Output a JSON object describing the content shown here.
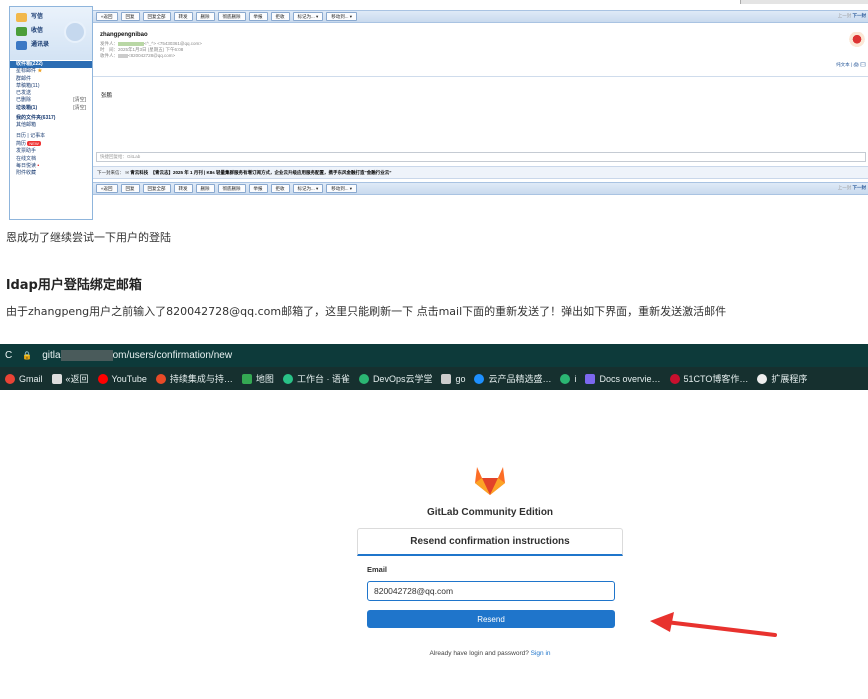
{
  "mail": {
    "nav_top": [
      "写信",
      "收信",
      "通讯录"
    ],
    "folders": [
      {
        "label": "收件箱(222)",
        "note": "",
        "selected": true
      },
      {
        "label": "星标邮件",
        "note": "★"
      },
      {
        "label": "群邮件",
        "note": ""
      },
      {
        "label": "草稿箱(11)",
        "note": ""
      },
      {
        "label": "已发送",
        "note": ""
      },
      {
        "label": "已删除",
        "note": "[清空]"
      },
      {
        "label": "垃圾箱(1)",
        "note": "[清空]"
      }
    ],
    "folders2": [
      {
        "label": "我的文件夹(6317)"
      },
      {
        "label": "其他邮箱"
      }
    ],
    "folders3": [
      {
        "label": "日历 | 记事本"
      },
      {
        "label": "简历",
        "note": "NEW"
      },
      {
        "label": "发票助手"
      },
      {
        "label": "在线文档"
      },
      {
        "label": "每日悦读",
        "note": "•"
      },
      {
        "label": "附件收藏"
      }
    ],
    "toolbar": [
      "«返回",
      "回复",
      "回复全部",
      "转发",
      "删除",
      "彻底删除",
      "举报",
      "拒收",
      "标记为... ▾",
      "移动到... ▾"
    ],
    "nav_right": {
      "prev": "上一封",
      "next": "下一封"
    },
    "subject": "zhangpengnibao",
    "sender_label": "发件人：",
    "sender_value": "<^_^> <75430361@qq.com>",
    "time_label": "时　间：",
    "time_value": "2025年1月3日 (星期五) 下午6:08",
    "to_label": "收件人：",
    "to_value": "<820042728@qq.com>",
    "plain_link": "纯文本 | 🖨 ✉",
    "body": "张鹏",
    "reply_placeholder": "快捷回复给：GitLab",
    "next_label": "下一封来信：",
    "next_sender": "青云科技",
    "next_subject": "【青云志】2025 年 1 月刊 | K8s 轻量集群服务有增订阅方式，企业云升级应用服务配置，携手东风金融打造“金融行业云”"
  },
  "article": {
    "line1": "恩成功了继续尝试一下用户的登陆",
    "heading": "ldap用户登陆绑定邮箱",
    "para": "由于zhangpeng用户之前输入了820042728@qq.com邮箱了，这里只能刷新一下 点击mail下面的重新发送了！弹出如下界面，重新发送激活邮件"
  },
  "browser": {
    "url_prefix": "gitla",
    "url_suffix": "om/users/confirmation/new",
    "bookmarks": [
      {
        "label": "Gmail",
        "color": "#ea4335"
      },
      {
        "label": "«返回",
        "color": "#dddddd"
      },
      {
        "label": "YouTube",
        "color": "#ff0000"
      },
      {
        "label": "持续集成与持…",
        "color": "#e84a27"
      },
      {
        "label": "地图",
        "color": "#34a853"
      },
      {
        "label": "工作台 · 语雀",
        "color": "#29c287"
      },
      {
        "label": "DevOps云学堂",
        "color": "#2bb673"
      },
      {
        "label": "go",
        "color": "#cccccc"
      },
      {
        "label": "云产品精选盛…",
        "color": "#1e90ff"
      },
      {
        "label": "i",
        "color": "#2bb673"
      },
      {
        "label": "Docs overvie…",
        "color": "#7b68ee"
      },
      {
        "label": "51CTO博客作…",
        "color": "#c8102e"
      },
      {
        "label": "扩展程序",
        "color": "#eeeeee"
      }
    ]
  },
  "gitlab": {
    "product": "GitLab Community Edition",
    "card_title": "Resend confirmation instructions",
    "email_label": "Email",
    "email_value": "820042728@qq.com",
    "resend_label": "Resend",
    "already_text": "Already have login and password?",
    "signin_link": "Sign in"
  },
  "colors": {
    "accent": "#1f75cb",
    "arrow": "#e8322e",
    "browser_bar": "#0d3a3a"
  }
}
